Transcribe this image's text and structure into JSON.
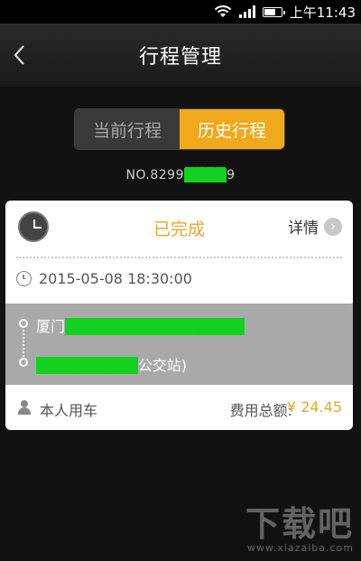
{
  "status_bar": {
    "time": "上午11:43",
    "icons": [
      "wifi-icon",
      "signal-icon",
      "battery-icon"
    ]
  },
  "header": {
    "title": "行程管理",
    "back_icon": "chevron-left-icon"
  },
  "tabs": [
    {
      "label": "当前行程",
      "active": false
    },
    {
      "label": "历史行程",
      "active": true
    }
  ],
  "order": {
    "prefix": "NO.8299",
    "suffix": "9"
  },
  "trip": {
    "status": "已完成",
    "detail_label": "详情",
    "datetime": "2015-05-08 18:30:00",
    "start_prefix": "厦门",
    "end_suffix": "公交站)",
    "usage_type": "本人用车",
    "fee_label": "费用总额:",
    "fee_value": "¥ 24.45"
  },
  "watermark": {
    "logo": "下载吧",
    "url": "www.xiazaiba.com"
  },
  "colors": {
    "accent": "#f0a91c",
    "status": "#e8a72a",
    "background": "#121212"
  }
}
